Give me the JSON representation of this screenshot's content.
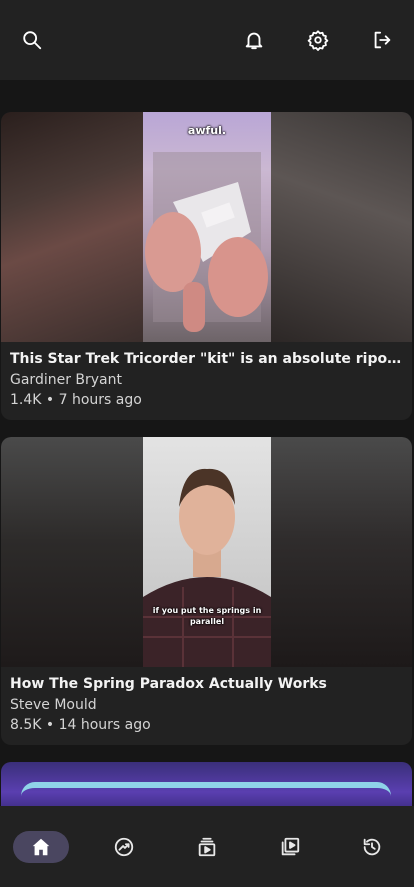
{
  "header": {
    "icons": [
      "search-icon",
      "bell-icon",
      "gear-icon",
      "logout-icon"
    ]
  },
  "feed": {
    "videos": [
      {
        "thumb_overlay": "awful.",
        "title": "This Star Trek Tricorder \"kit\" is an absolute ripoff. #nex...",
        "channel": "Gardiner Bryant",
        "stats": "1.4K • 7 hours ago"
      },
      {
        "thumb_overlay": "if you put the springs in parallel",
        "title": "How The Spring Paradox Actually Works",
        "channel": "Steve Mould",
        "stats": "8.5K • 14 hours ago"
      }
    ]
  },
  "bottom_nav": {
    "items": [
      "home-icon",
      "trending-icon",
      "subscriptions-icon",
      "library-icon",
      "history-icon"
    ],
    "active": "home-icon"
  },
  "colors": {
    "background": "#161616",
    "surface": "#222222",
    "active_nav": "#4a4660"
  }
}
